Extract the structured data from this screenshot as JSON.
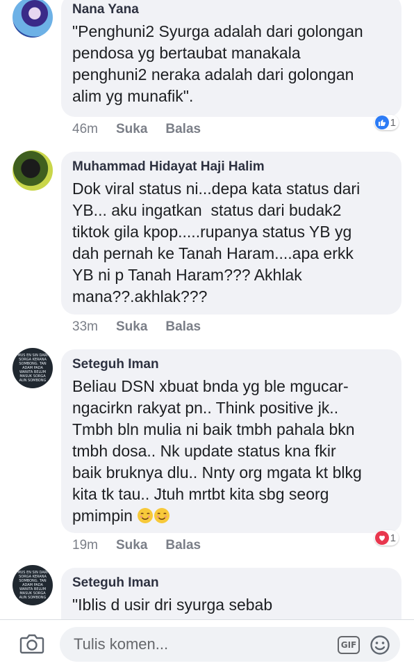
{
  "comments": [
    {
      "author": "Nana Yana",
      "text": "\"Penghuni2 Syurga adalah dari golongan\npendosa yg bertaubat manakala\npenghuni2 neraka adalah dari golongan\nalim yg munafik\".",
      "time": "46m",
      "like": "Suka",
      "reply": "Balas",
      "reaction_count": "1",
      "reaction": "like-icon"
    },
    {
      "author": "Muhammad Hidayat Haji Halim",
      "text": "Dok viral status ni...depa kata status dari\nYB... aku ingatkan  status dari budak2\ntiktok gila kpop.....rupanya status YB yg\ndah pernah ke Tanah Haram....apa erkk\nYB ni p Tanah Haram??? Akhlak\nmana??.akhlak???",
      "time": "33m",
      "like": "Suka",
      "reply": "Balas"
    },
    {
      "author": "Seteguh Iman",
      "text": "Beliau DSN xbuat bnda yg ble mgucar-\nngacirkn rakyat pn.. Think positive jk..\nTmbh bln mulia ni baik tmbh pahala bkn\ntmbh dosa.. Nk update status kna fkir\nbaik bruknya dlu.. Nnty org mgata kt blkg\nkita tk tau.. Jtuh mrtbt kita sbg seorg\npmimpin ",
      "emoji": [
        "smiling-face-icon",
        "smiling-face-icon"
      ],
      "time": "19m",
      "like": "Suka",
      "reply": "Balas",
      "reaction_count": "1",
      "reaction": "love-icon"
    },
    {
      "author": "Seteguh Iman",
      "text": "\"Iblis d usir dri syurga sebab"
    }
  ],
  "avatar_text": "MUS EN SIN DARI SORGA KERANA SOMBONG. TAN ADAM PADA WANITA BELUM MASUK SORGA AUN SOMBONG",
  "composer": {
    "placeholder": "Tulis komen...",
    "gif_label": "GIF"
  },
  "colors": {
    "bubble": "#f1f2f6",
    "like_blue": "#2d7cf6",
    "love_red": "#e8374e",
    "meta_gray": "#7a7e87"
  }
}
